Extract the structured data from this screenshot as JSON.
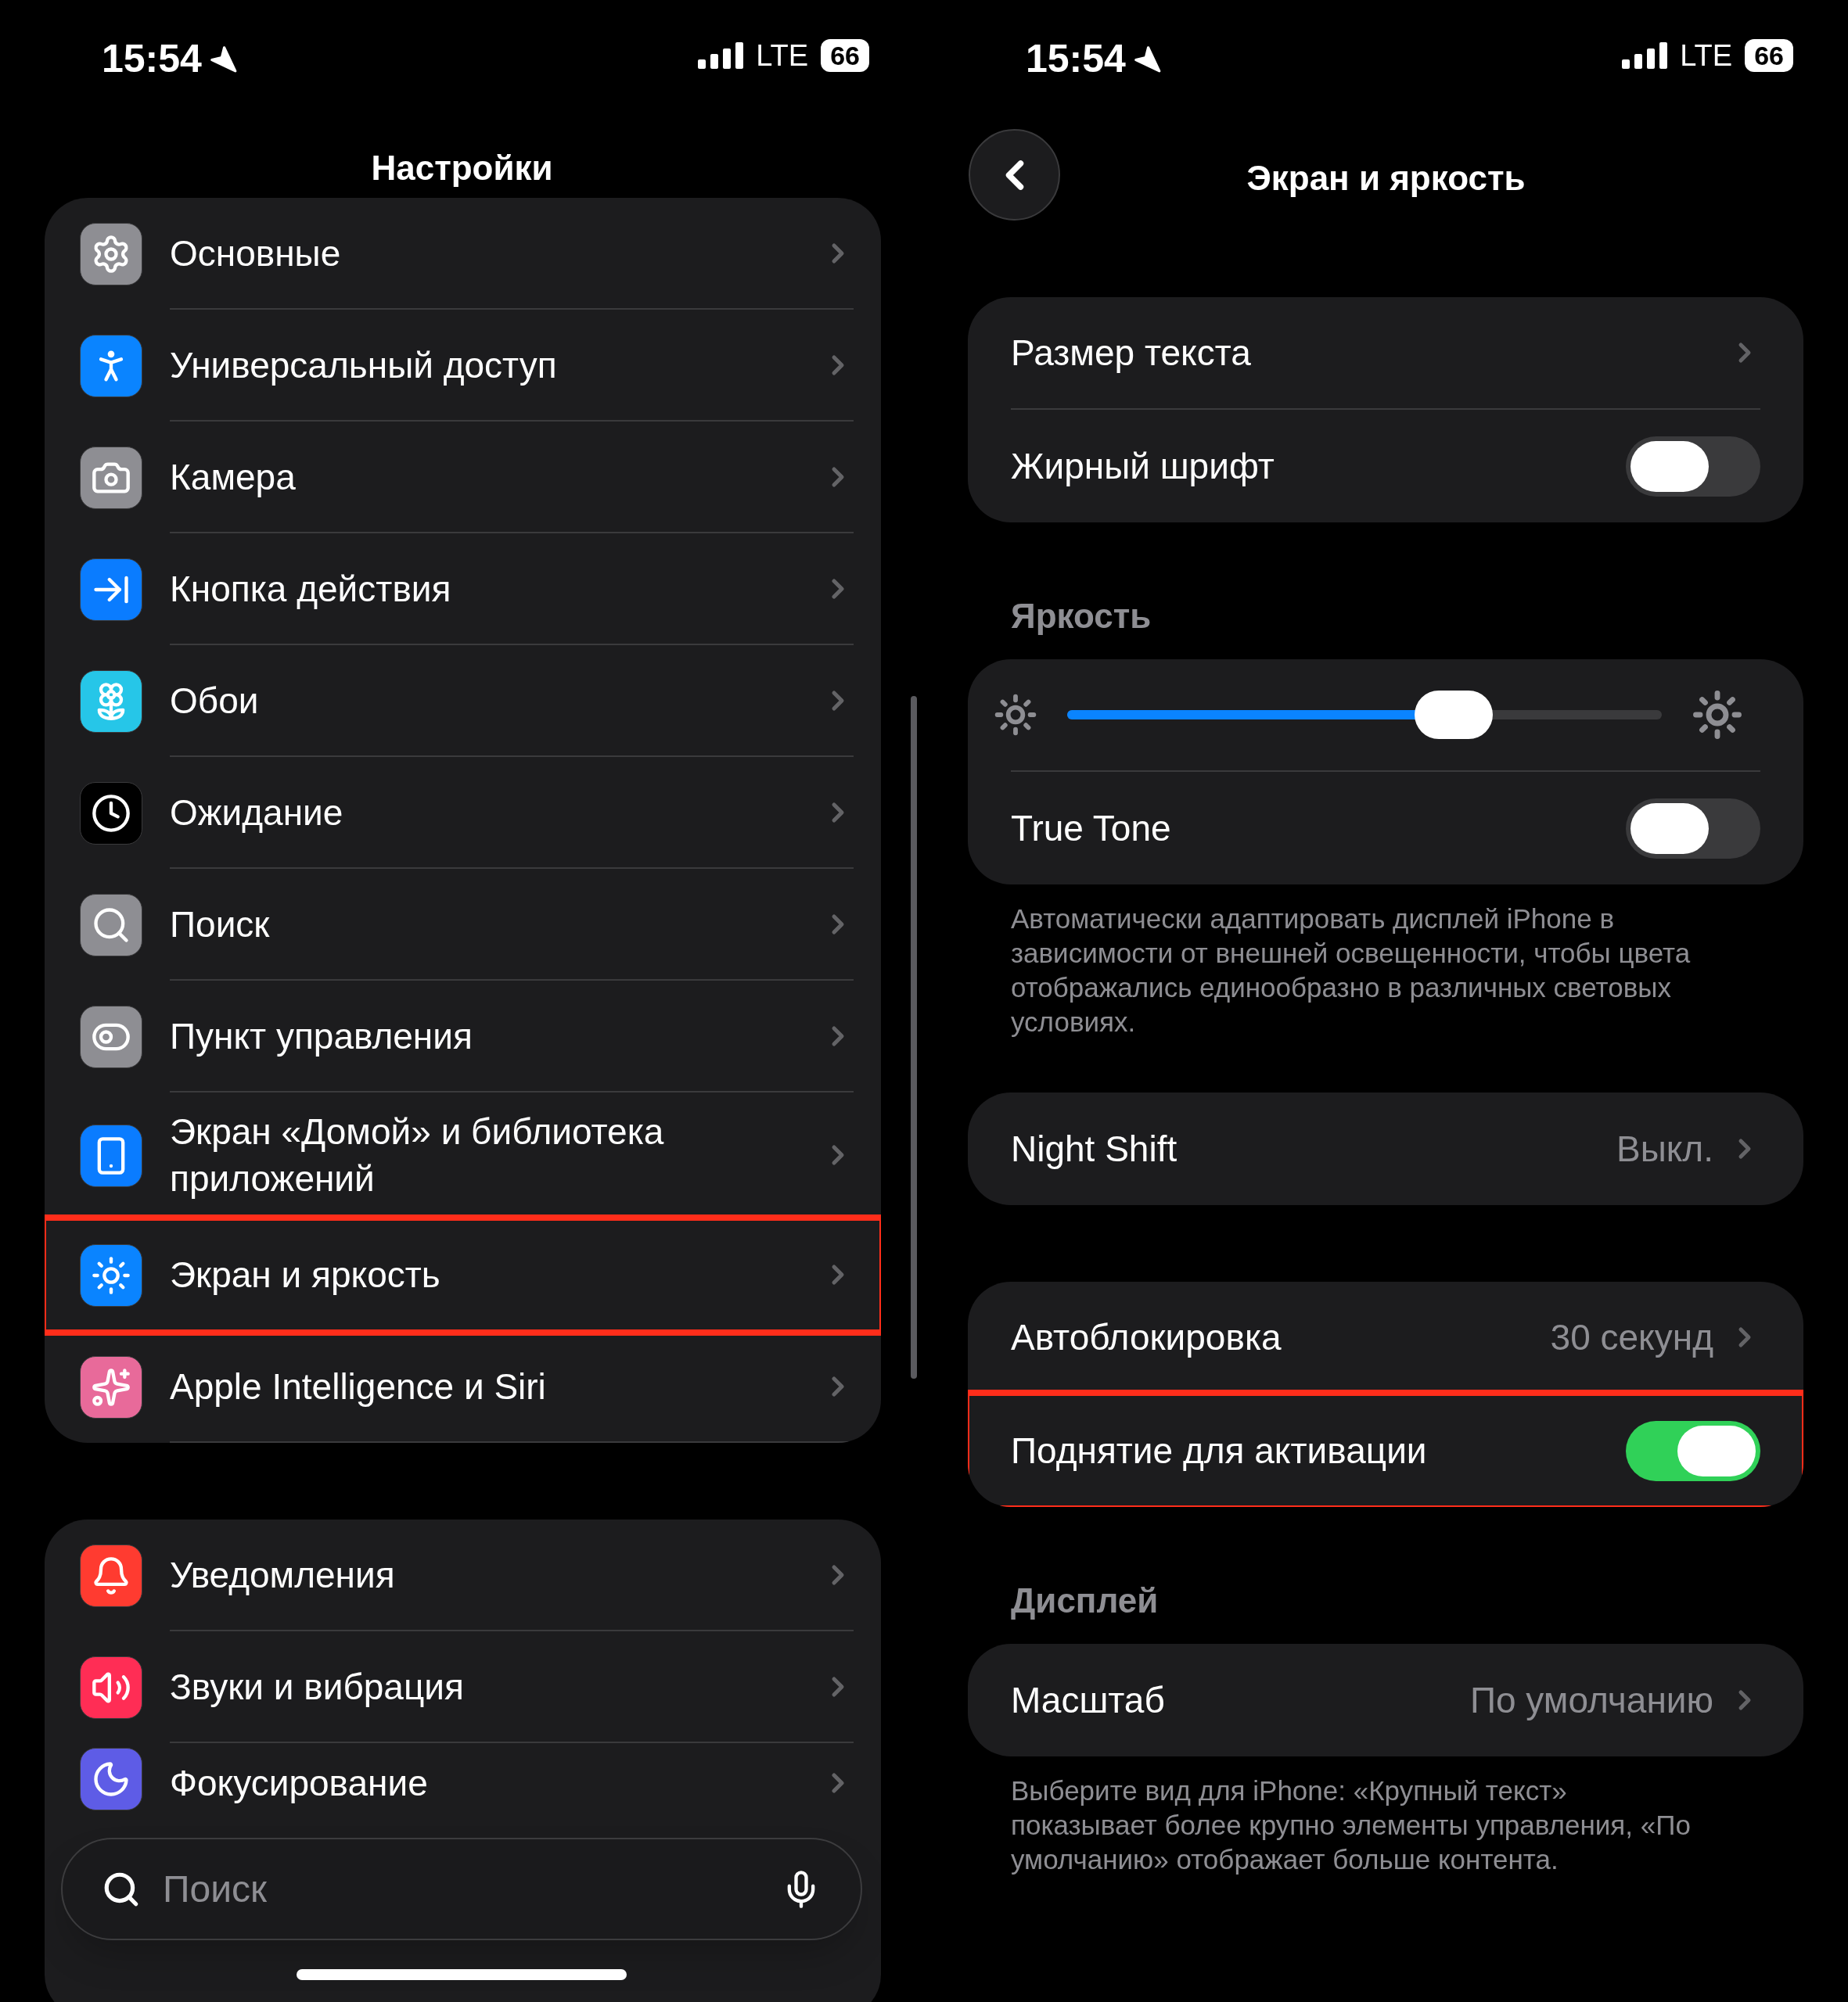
{
  "left": {
    "status": {
      "time": "15:54",
      "network": "LTE",
      "battery": "66"
    },
    "title": "Настройки",
    "groups": [
      {
        "items": [
          {
            "label": "Основные",
            "color": "#8e8e93",
            "highlighted": false
          },
          {
            "label": "Универсальный доступ",
            "color": "#0a84ff",
            "highlighted": false
          },
          {
            "label": "Камера",
            "color": "#8e8e93",
            "highlighted": false
          },
          {
            "label": "Кнопка действия",
            "color": "#0a7cff",
            "highlighted": false
          },
          {
            "label": "Обои",
            "color": "#26c6e8",
            "highlighted": false
          },
          {
            "label": "Ожидание",
            "color": "#000000",
            "highlighted": false
          },
          {
            "label": "Поиск",
            "color": "#8e8e93",
            "highlighted": false
          },
          {
            "label": "Пункт управления",
            "color": "#8e8e93",
            "highlighted": false
          },
          {
            "label": "Экран «Домой» и библиотека приложений",
            "color": "#0a7cff",
            "highlighted": false
          },
          {
            "label": "Экран и яркость",
            "color": "#0a84ff",
            "highlighted": true
          },
          {
            "label": "Apple Intelligence и Siri",
            "color": "#e86a9a",
            "highlighted": false
          }
        ]
      },
      {
        "items": [
          {
            "label": "Уведомления",
            "color": "#ff3b30",
            "highlighted": false
          },
          {
            "label": "Звуки и вибрация",
            "color": "#ff2d55",
            "highlighted": false
          },
          {
            "label": "Фокусирование",
            "color": "#5e5ce6",
            "highlighted": false
          }
        ]
      }
    ],
    "search": {
      "placeholder": "Поиск"
    }
  },
  "right": {
    "status": {
      "time": "15:54",
      "network": "LTE",
      "battery": "66"
    },
    "title": "Экран и яркость",
    "sections": [
      {
        "rows": [
          {
            "kind": "link",
            "label": "Размер текста",
            "highlighted": false
          },
          {
            "kind": "toggle",
            "label": "Жирный шрифт",
            "on": false,
            "highlighted": false
          }
        ]
      },
      {
        "header": "Яркость",
        "rows": [
          {
            "kind": "slider",
            "level": 0.65,
            "highlighted": false
          },
          {
            "kind": "toggle",
            "label": "True Tone",
            "on": false,
            "highlighted": false
          }
        ],
        "footer": "Автоматически адаптировать дисплей iPhone в зависимости от внешней освещенности, чтобы цвета отображались единообразно в различных световых условиях."
      },
      {
        "rows": [
          {
            "kind": "link",
            "label": "Night Shift",
            "value": "Выкл.",
            "highlighted": false
          }
        ]
      },
      {
        "rows": [
          {
            "kind": "link",
            "label": "Автоблокировка",
            "value": "30 секунд",
            "highlighted": false
          },
          {
            "kind": "toggle",
            "label": "Поднятие для активации",
            "on": true,
            "highlighted": true
          }
        ]
      },
      {
        "header": "Дисплей",
        "rows": [
          {
            "kind": "link",
            "label": "Масштаб",
            "value": "По умолчанию",
            "highlighted": false
          }
        ],
        "footer": "Выберите вид для iPhone: «Крупный текст» показывает более крупно элементы управления, «По умолчанию» отображает больше контента."
      }
    ]
  }
}
